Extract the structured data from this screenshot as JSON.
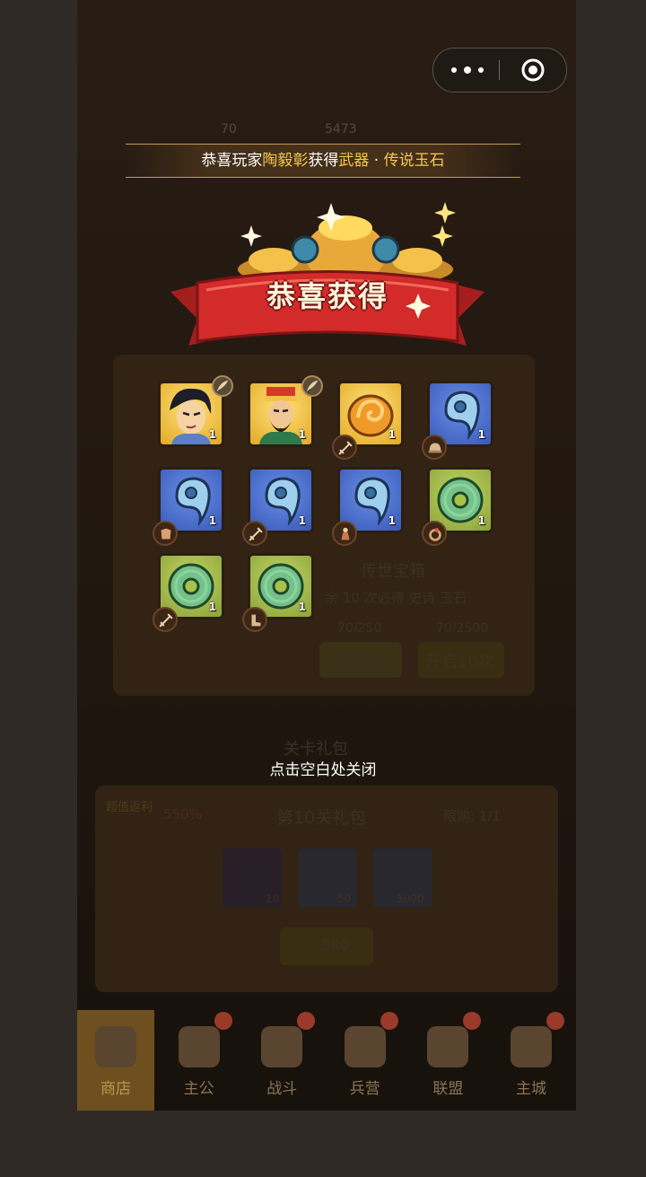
{
  "background": {
    "top_numbers": [
      "70",
      "5473"
    ],
    "chest_title": "传世宝箱",
    "chest_hint": "余 10 次必得 史诗 玉石",
    "chest_counts": [
      "70/250",
      "70/2500"
    ],
    "open_once": "开启1次",
    "open_ten": "开启10次",
    "stage_pack_title": "关卡礼包",
    "value_tag": "超值返利",
    "value_percent": "550%",
    "pack_name": "第10关礼包",
    "limit": "限购: 1/1",
    "pack_items": [
      "10",
      "50",
      "5000"
    ],
    "price": "980"
  },
  "capsule": {
    "menu_icon": "more-dots-icon",
    "close_icon": "target-icon"
  },
  "broadcast": {
    "prefix": "恭喜玩家",
    "player": "陶毅彰",
    "middle": "获得",
    "item_type": "武器",
    "separator": " · ",
    "item_name": "传说玉石"
  },
  "banner": {
    "title": "恭喜获得"
  },
  "rewards": [
    {
      "kind": "hero-young",
      "frame": "gold",
      "qty": "1",
      "badge": "feather-icon"
    },
    {
      "kind": "hero-general",
      "frame": "gold",
      "qty": "1",
      "badge": "feather-icon"
    },
    {
      "kind": "jade-swirl",
      "frame": "gold",
      "qty": "1",
      "badge": "sword-icon"
    },
    {
      "kind": "jade-comma",
      "frame": "blue",
      "qty": "1",
      "badge": "helmet-icon"
    },
    {
      "kind": "jade-comma",
      "frame": "blue",
      "qty": "1",
      "badge": "armor-icon"
    },
    {
      "kind": "jade-comma",
      "frame": "blue",
      "qty": "1",
      "badge": "sword-icon"
    },
    {
      "kind": "jade-comma",
      "frame": "blue",
      "qty": "1",
      "badge": "robe-icon"
    },
    {
      "kind": "jade-disc",
      "frame": "green",
      "qty": "1",
      "badge": "ring-icon"
    },
    {
      "kind": "jade-disc",
      "frame": "green",
      "qty": "1",
      "badge": "sword-icon"
    },
    {
      "kind": "jade-disc",
      "frame": "green",
      "qty": "1",
      "badge": "boot-icon"
    }
  ],
  "close_hint": "点击空白处关闭",
  "nav": [
    {
      "label": "商店",
      "icon": "shop-icon",
      "active": true
    },
    {
      "label": "主公",
      "icon": "lord-icon",
      "active": false
    },
    {
      "label": "战斗",
      "icon": "battle-icon",
      "active": false
    },
    {
      "label": "兵营",
      "icon": "barracks-icon",
      "active": false
    },
    {
      "label": "联盟",
      "icon": "alliance-icon",
      "active": false
    },
    {
      "label": "主城",
      "icon": "city-icon",
      "active": false
    }
  ],
  "colors": {
    "accent_gold": "#f5c84a",
    "banner_red": "#d32a2a"
  }
}
